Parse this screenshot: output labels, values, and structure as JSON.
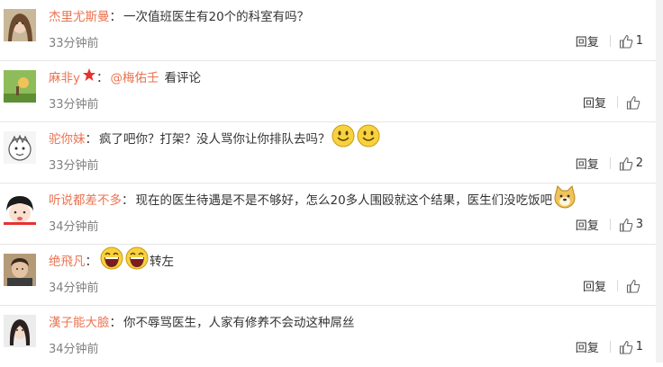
{
  "comments": [
    {
      "user": "杰里尤斯曼",
      "text": "一次值班医生有20个的科室有吗？",
      "time": "33分钟前",
      "reply": "回复",
      "likes": "1"
    },
    {
      "user": "麻非y",
      "mention": "@梅佑壬",
      "text": "看评论",
      "time": "33分钟前",
      "reply": "回复",
      "likes": ""
    },
    {
      "user": "驼你妹",
      "text": "疯了吧你？打架？没人骂你让你排队去吗？",
      "time": "33分钟前",
      "reply": "回复",
      "likes": "2"
    },
    {
      "user": "听说都差不多",
      "text": "现在的医生待遇是不是不够好，怎么20多人围殴就这个结果，医生们没吃饭吧",
      "time": "34分钟前",
      "reply": "回复",
      "likes": "3"
    },
    {
      "user": "绝飛凡",
      "text": "转左",
      "time": "34分钟前",
      "reply": "回复",
      "likes": ""
    },
    {
      "user": "漢子能大臉",
      "text": "你不辱骂医生，人家有修养不会动这种屌丝",
      "time": "34分钟前",
      "reply": "回复",
      "likes": "1"
    }
  ],
  "colors": {
    "username": "#eb7350",
    "text": "#333333",
    "time": "#808080"
  }
}
